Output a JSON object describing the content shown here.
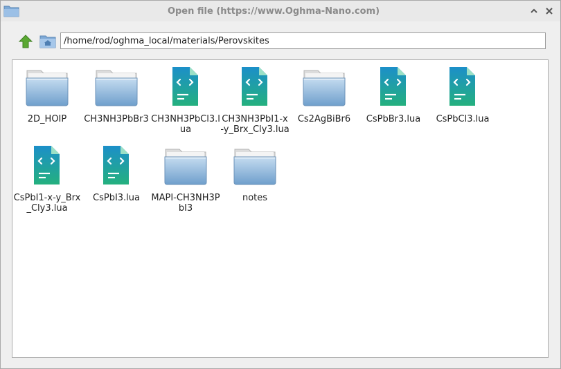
{
  "window": {
    "title": "Open file (https://www.Oghma-Nano.com)"
  },
  "toolbar": {
    "up_icon": "up-arrow-icon",
    "home_icon": "home-folder-icon",
    "path": "/home/rod/oghma_local/materials/Perovskites"
  },
  "colors": {
    "folder": "#8fb6dc",
    "file_top": "#1c8fc9",
    "file_bottom": "#24b07e",
    "up_arrow": "#5aa832"
  },
  "files": [
    {
      "type": "folder",
      "name": "2D_HOIP"
    },
    {
      "type": "folder",
      "name": "CH3NH3PbBr3"
    },
    {
      "type": "lua",
      "name": "CH3NH3PbCl3.lua"
    },
    {
      "type": "lua",
      "name": "CH3NH3PbI1-x-y_Brx_Cly3.lua"
    },
    {
      "type": "folder",
      "name": "Cs2AgBiBr6"
    },
    {
      "type": "lua",
      "name": "CsPbBr3.lua"
    },
    {
      "type": "lua",
      "name": "CsPbCl3.lua"
    },
    {
      "type": "lua",
      "name": "CsPbI1-x-y_Brx_Cly3.lua"
    },
    {
      "type": "lua",
      "name": "CsPbI3.lua"
    },
    {
      "type": "folder",
      "name": "MAPI-CH3NH3PbI3"
    },
    {
      "type": "folder",
      "name": "notes"
    }
  ]
}
